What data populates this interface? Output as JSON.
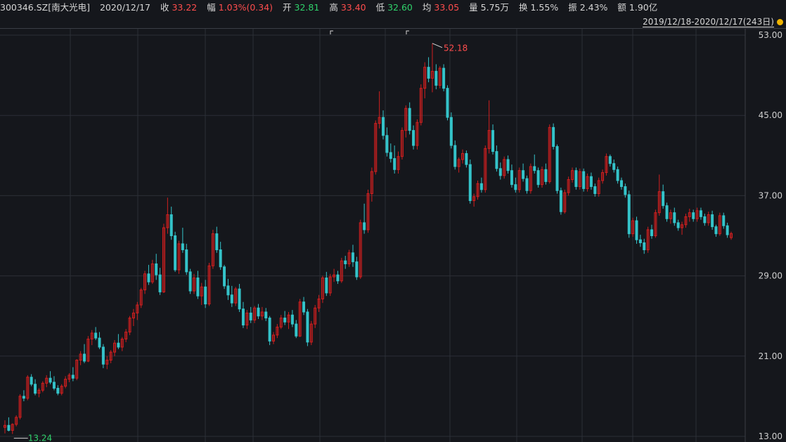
{
  "header": {
    "code": "300346.SZ[南大光电]",
    "date": "2020/12/17",
    "close_label": "收",
    "close_value": "33.22",
    "change_label": "幅",
    "change_value": "1.03%(0.34)",
    "open_label": "开",
    "open_value": "32.81",
    "high_label": "高",
    "high_value": "33.40",
    "low_label": "低",
    "low_value": "32.60",
    "avg_label": "均",
    "avg_value": "33.05",
    "volume_label": "量",
    "volume_value": "5.75万",
    "turnover_label": "换",
    "turnover_value": "1.55%",
    "amplitude_label": "振",
    "amplitude_value": "2.43%",
    "amount_label": "额",
    "amount_value": "1.90亿"
  },
  "range_label": "2019/12/18-2020/12/17(243日)",
  "colors": {
    "up": "#ff4d4d",
    "down": "#2fd26b",
    "up_candle": "#d11f1f",
    "down_candle": "#34c3c9",
    "grid": "#2c2f36",
    "background": "#15171c"
  },
  "chart_data": {
    "type": "candlestick",
    "y_axis_ticks": [
      "53.00",
      "45.00",
      "37.00",
      "29.00",
      "21.00",
      "13.00"
    ],
    "ylim": [
      13,
      53
    ],
    "max_marker": "52.18",
    "min_marker": "13.24",
    "ohlc": [
      [
        13.9,
        14.6,
        13.3,
        14.1
      ],
      [
        14.1,
        14.9,
        13.5,
        13.6
      ],
      [
        13.6,
        14.3,
        13.24,
        14.2
      ],
      [
        14.2,
        15.1,
        14.0,
        14.9
      ],
      [
        14.9,
        17.2,
        14.7,
        17.0
      ],
      [
        17.0,
        17.6,
        16.5,
        16.8
      ],
      [
        16.8,
        19.1,
        16.6,
        18.9
      ],
      [
        18.9,
        19.2,
        18.0,
        18.2
      ],
      [
        18.2,
        18.7,
        17.1,
        17.3
      ],
      [
        17.3,
        17.8,
        16.9,
        17.6
      ],
      [
        17.6,
        18.5,
        17.4,
        18.3
      ],
      [
        18.3,
        19.1,
        17.9,
        18.8
      ],
      [
        18.8,
        19.5,
        18.2,
        18.4
      ],
      [
        18.4,
        19.0,
        17.6,
        17.8
      ],
      [
        17.8,
        18.1,
        17.1,
        17.3
      ],
      [
        17.3,
        18.2,
        17.1,
        18.0
      ],
      [
        18.0,
        19.0,
        17.8,
        18.7
      ],
      [
        18.7,
        19.3,
        18.4,
        19.1
      ],
      [
        19.1,
        19.9,
        18.5,
        18.8
      ],
      [
        18.8,
        20.7,
        18.6,
        20.6
      ],
      [
        20.6,
        21.5,
        20.1,
        21.2
      ],
      [
        21.2,
        22.2,
        20.3,
        20.5
      ],
      [
        20.5,
        23.0,
        20.4,
        22.7
      ],
      [
        22.7,
        23.6,
        22.1,
        23.3
      ],
      [
        23.3,
        23.9,
        22.6,
        22.8
      ],
      [
        22.8,
        23.4,
        21.7,
        21.9
      ],
      [
        21.9,
        22.2,
        19.8,
        20.2
      ],
      [
        20.2,
        21.0,
        19.7,
        20.6
      ],
      [
        20.6,
        21.6,
        20.3,
        21.4
      ],
      [
        21.4,
        22.6,
        21.0,
        22.3
      ],
      [
        22.3,
        23.2,
        21.7,
        21.9
      ],
      [
        21.9,
        22.9,
        21.5,
        22.7
      ],
      [
        22.7,
        23.7,
        22.4,
        23.4
      ],
      [
        23.4,
        25.0,
        23.1,
        24.8
      ],
      [
        24.8,
        25.7,
        24.0,
        25.3
      ],
      [
        25.3,
        26.4,
        24.6,
        26.1
      ],
      [
        26.1,
        27.8,
        25.8,
        27.6
      ],
      [
        27.6,
        29.5,
        27.2,
        29.2
      ],
      [
        29.2,
        30.1,
        28.1,
        28.4
      ],
      [
        28.4,
        30.6,
        28.2,
        30.2
      ],
      [
        30.2,
        31.2,
        28.6,
        29.1
      ],
      [
        29.1,
        29.8,
        27.1,
        27.4
      ],
      [
        27.4,
        34.2,
        27.3,
        33.8
      ],
      [
        33.8,
        36.8,
        33.2,
        35.1
      ],
      [
        35.1,
        35.9,
        32.6,
        33.0
      ],
      [
        33.0,
        33.4,
        29.4,
        29.6
      ],
      [
        29.6,
        32.5,
        29.2,
        32.2
      ],
      [
        32.2,
        33.8,
        31.3,
        31.6
      ],
      [
        31.6,
        32.2,
        29.1,
        29.4
      ],
      [
        29.4,
        29.7,
        27.2,
        27.5
      ],
      [
        27.5,
        29.2,
        27.2,
        28.8
      ],
      [
        28.8,
        29.5,
        26.7,
        27.0
      ],
      [
        27.0,
        28.3,
        26.1,
        27.9
      ],
      [
        27.9,
        28.6,
        25.8,
        26.2
      ],
      [
        26.2,
        30.3,
        26.0,
        30.0
      ],
      [
        30.0,
        33.6,
        29.7,
        33.2
      ],
      [
        33.2,
        33.9,
        31.3,
        31.6
      ],
      [
        31.6,
        32.4,
        29.6,
        29.9
      ],
      [
        29.9,
        30.1,
        27.7,
        28.0
      ],
      [
        28.0,
        28.7,
        26.6,
        27.1
      ],
      [
        27.1,
        28.0,
        25.9,
        26.3
      ],
      [
        26.3,
        27.9,
        26.0,
        27.7
      ],
      [
        27.7,
        28.2,
        25.4,
        25.7
      ],
      [
        25.7,
        26.4,
        23.8,
        24.1
      ],
      [
        24.1,
        25.6,
        23.7,
        25.3
      ],
      [
        25.3,
        25.9,
        24.3,
        24.6
      ],
      [
        24.6,
        26.0,
        24.3,
        25.8
      ],
      [
        25.8,
        26.2,
        24.7,
        25.0
      ],
      [
        25.0,
        25.9,
        24.6,
        25.4
      ],
      [
        25.4,
        25.8,
        24.5,
        24.8
      ],
      [
        24.8,
        25.0,
        22.1,
        22.5
      ],
      [
        22.5,
        23.4,
        22.2,
        23.1
      ],
      [
        23.1,
        24.2,
        22.8,
        23.9
      ],
      [
        23.9,
        25.1,
        23.7,
        24.8
      ],
      [
        24.8,
        25.5,
        24.1,
        24.4
      ],
      [
        24.4,
        25.4,
        23.7,
        25.1
      ],
      [
        25.1,
        25.6,
        23.9,
        24.2
      ],
      [
        24.2,
        24.6,
        22.8,
        23.0
      ],
      [
        23.0,
        26.7,
        22.9,
        26.4
      ],
      [
        26.4,
        26.9,
        25.1,
        25.4
      ],
      [
        25.4,
        25.7,
        22.0,
        22.4
      ],
      [
        22.4,
        24.5,
        22.1,
        24.2
      ],
      [
        24.2,
        26.1,
        23.8,
        25.8
      ],
      [
        25.8,
        27.1,
        25.4,
        26.7
      ],
      [
        26.7,
        29.0,
        26.3,
        28.8
      ],
      [
        28.8,
        29.4,
        27.0,
        27.3
      ],
      [
        27.3,
        29.2,
        27.0,
        28.9
      ],
      [
        28.9,
        29.7,
        28.4,
        29.1
      ],
      [
        29.1,
        29.5,
        28.2,
        28.5
      ],
      [
        28.5,
        30.8,
        28.3,
        30.5
      ],
      [
        30.5,
        31.0,
        29.7,
        30.2
      ],
      [
        30.2,
        31.6,
        29.9,
        31.3
      ],
      [
        31.3,
        32.1,
        29.9,
        30.4
      ],
      [
        30.4,
        30.9,
        28.6,
        28.9
      ],
      [
        28.9,
        34.6,
        28.7,
        34.3
      ],
      [
        34.3,
        36.2,
        33.2,
        33.6
      ],
      [
        33.6,
        37.6,
        33.3,
        37.2
      ],
      [
        37.2,
        39.8,
        36.4,
        39.4
      ],
      [
        39.4,
        44.5,
        39.1,
        44.2
      ],
      [
        44.2,
        47.4,
        43.7,
        44.8
      ],
      [
        44.8,
        45.5,
        42.6,
        43.0
      ],
      [
        43.0,
        43.8,
        40.9,
        41.3
      ],
      [
        41.3,
        42.2,
        40.3,
        40.7
      ],
      [
        40.7,
        42.0,
        39.2,
        39.6
      ],
      [
        39.6,
        41.4,
        39.2,
        40.9
      ],
      [
        40.9,
        43.8,
        40.6,
        43.5
      ],
      [
        43.5,
        46.0,
        42.8,
        45.7
      ],
      [
        45.7,
        46.3,
        43.1,
        43.5
      ],
      [
        43.5,
        44.0,
        41.6,
        42.0
      ],
      [
        42.0,
        44.6,
        41.6,
        44.3
      ],
      [
        44.3,
        48.1,
        44.0,
        47.7
      ],
      [
        47.7,
        50.3,
        46.7,
        49.8
      ],
      [
        49.8,
        50.8,
        48.3,
        48.7
      ],
      [
        48.7,
        52.18,
        47.3,
        49.4
      ],
      [
        49.4,
        50.1,
        47.6,
        48.0
      ],
      [
        48.0,
        49.9,
        47.7,
        49.7
      ],
      [
        49.7,
        50.1,
        47.4,
        47.7
      ],
      [
        47.7,
        48.0,
        44.5,
        44.8
      ],
      [
        44.8,
        45.3,
        41.7,
        42.0
      ],
      [
        42.0,
        42.5,
        39.6,
        39.9
      ],
      [
        39.9,
        40.8,
        39.3,
        40.6
      ],
      [
        40.6,
        41.6,
        40.2,
        41.2
      ],
      [
        41.2,
        41.5,
        39.8,
        40.1
      ],
      [
        40.1,
        40.6,
        36.2,
        36.5
      ],
      [
        36.5,
        37.2,
        35.9,
        36.9
      ],
      [
        36.9,
        38.5,
        36.6,
        38.2
      ],
      [
        38.2,
        38.8,
        37.3,
        37.6
      ],
      [
        37.6,
        42.0,
        37.3,
        41.7
      ],
      [
        41.7,
        46.5,
        41.2,
        43.5
      ],
      [
        43.5,
        44.1,
        41.1,
        41.4
      ],
      [
        41.4,
        42.0,
        39.4,
        39.7
      ],
      [
        39.7,
        40.3,
        38.6,
        39.0
      ],
      [
        39.0,
        40.9,
        38.7,
        40.6
      ],
      [
        40.6,
        41.0,
        39.2,
        39.5
      ],
      [
        39.5,
        40.1,
        37.8,
        38.1
      ],
      [
        38.1,
        38.8,
        37.3,
        37.6
      ],
      [
        37.6,
        39.8,
        37.3,
        39.5
      ],
      [
        39.5,
        40.2,
        38.4,
        38.7
      ],
      [
        38.7,
        39.0,
        37.2,
        37.5
      ],
      [
        37.5,
        40.2,
        37.2,
        39.9
      ],
      [
        39.9,
        41.1,
        39.2,
        39.5
      ],
      [
        39.5,
        39.8,
        37.8,
        38.1
      ],
      [
        38.1,
        39.9,
        37.8,
        39.6
      ],
      [
        39.6,
        40.2,
        38.1,
        38.4
      ],
      [
        38.4,
        44.1,
        38.2,
        43.8
      ],
      [
        43.8,
        44.2,
        41.6,
        41.9
      ],
      [
        41.9,
        42.1,
        37.2,
        37.5
      ],
      [
        37.5,
        37.8,
        35.1,
        35.4
      ],
      [
        35.4,
        37.6,
        35.2,
        37.3
      ],
      [
        37.3,
        38.9,
        37.0,
        38.6
      ],
      [
        38.6,
        39.8,
        38.3,
        39.5
      ],
      [
        39.5,
        39.8,
        37.6,
        37.9
      ],
      [
        37.9,
        39.7,
        37.6,
        39.4
      ],
      [
        39.4,
        39.7,
        37.4,
        37.7
      ],
      [
        37.7,
        39.2,
        37.4,
        38.9
      ],
      [
        38.9,
        39.3,
        37.6,
        37.9
      ],
      [
        37.9,
        38.2,
        36.9,
        37.2
      ],
      [
        37.2,
        38.8,
        36.9,
        38.5
      ],
      [
        38.5,
        39.6,
        38.2,
        39.3
      ],
      [
        39.3,
        41.2,
        39.0,
        40.9
      ],
      [
        40.9,
        41.1,
        39.9,
        40.2
      ],
      [
        40.2,
        40.6,
        39.3,
        39.6
      ],
      [
        39.6,
        39.9,
        38.2,
        38.5
      ],
      [
        38.5,
        38.8,
        37.6,
        37.9
      ],
      [
        37.9,
        38.2,
        36.8,
        37.1
      ],
      [
        37.1,
        37.5,
        32.8,
        33.2
      ],
      [
        33.2,
        34.8,
        32.9,
        34.5
      ],
      [
        34.5,
        34.9,
        32.2,
        32.6
      ],
      [
        32.6,
        33.1,
        31.9,
        32.3
      ],
      [
        32.3,
        32.7,
        31.2,
        31.6
      ],
      [
        31.6,
        33.9,
        31.3,
        33.6
      ],
      [
        33.6,
        34.1,
        32.7,
        33.0
      ],
      [
        33.0,
        35.6,
        32.8,
        35.3
      ],
      [
        35.3,
        39.1,
        35.0,
        37.4
      ],
      [
        37.4,
        38.1,
        35.7,
        36.0
      ],
      [
        36.0,
        36.3,
        34.4,
        34.7
      ],
      [
        34.7,
        35.6,
        34.2,
        35.3
      ],
      [
        35.3,
        35.8,
        34.0,
        34.3
      ],
      [
        34.3,
        34.6,
        33.5,
        33.8
      ],
      [
        33.8,
        34.4,
        33.1,
        34.1
      ],
      [
        34.1,
        35.2,
        33.8,
        34.9
      ],
      [
        34.9,
        35.7,
        34.4,
        35.3
      ],
      [
        35.3,
        35.6,
        34.4,
        34.7
      ],
      [
        34.7,
        35.8,
        34.4,
        35.5
      ],
      [
        35.5,
        35.8,
        34.6,
        34.9
      ],
      [
        34.9,
        35.2,
        34.0,
        34.3
      ],
      [
        34.3,
        35.4,
        34.0,
        35.1
      ],
      [
        35.1,
        35.5,
        33.6,
        33.9
      ],
      [
        33.9,
        34.1,
        32.9,
        33.2
      ],
      [
        33.2,
        35.3,
        33.0,
        35.0
      ],
      [
        35.0,
        35.3,
        33.7,
        34.0
      ],
      [
        34.0,
        34.3,
        32.8,
        33.1
      ],
      [
        32.81,
        33.4,
        32.6,
        33.22
      ]
    ]
  }
}
